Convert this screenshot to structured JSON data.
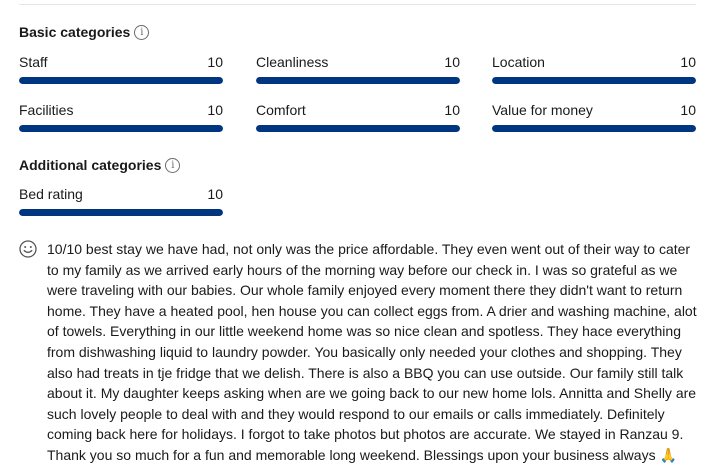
{
  "sections": {
    "basic_title": "Basic categories",
    "additional_title": "Additional categories",
    "info_glyph": "i"
  },
  "categories": {
    "basic": [
      {
        "label": "Staff",
        "score": "10",
        "fraction": 1.0
      },
      {
        "label": "Cleanliness",
        "score": "10",
        "fraction": 1.0
      },
      {
        "label": "Location",
        "score": "10",
        "fraction": 1.0
      },
      {
        "label": "Facilities",
        "score": "10",
        "fraction": 1.0
      },
      {
        "label": "Comfort",
        "score": "10",
        "fraction": 1.0
      },
      {
        "label": "Value for money",
        "score": "10",
        "fraction": 1.0
      }
    ],
    "additional": [
      {
        "label": "Bed rating",
        "score": "10",
        "fraction": 1.0
      }
    ]
  },
  "colors": {
    "bar_fill": "#003580",
    "bar_track": "#e7e7e7",
    "emoji": "#f2b51d"
  },
  "review": {
    "icon": "smile-icon",
    "text": "10/10 best stay we have had, not only was the price affordable. They even went out of their way to cater to my family as we arrived early hours of the morning way before our check in. I was so grateful as we were traveling with our babies. Our whole family enjoyed every moment there they didn't want to return home. They have a heated pool, hen house you can collect eggs from. A drier and washing machine, alot of towels. Everything in our little weekend home was so nice clean and spotless. They hace everything from dishwashing liquid to laundry powder. You basically only needed your clothes and shopping. They also had treats in tje fridge that we delish. There is also a BBQ you can use outside. Our family still talk about it. My daughter keeps asking when are we going back to our new home lols. Annitta and Shelly are such lovely people to deal with and they would respond to our emails or calls immediately. Definitely coming back here for holidays. I forgot to take photos but photos are accurate. We stayed in Ranzau 9. Thank you so much for a fun and memorable long weekend. Blessings upon your business always 🙏"
  }
}
